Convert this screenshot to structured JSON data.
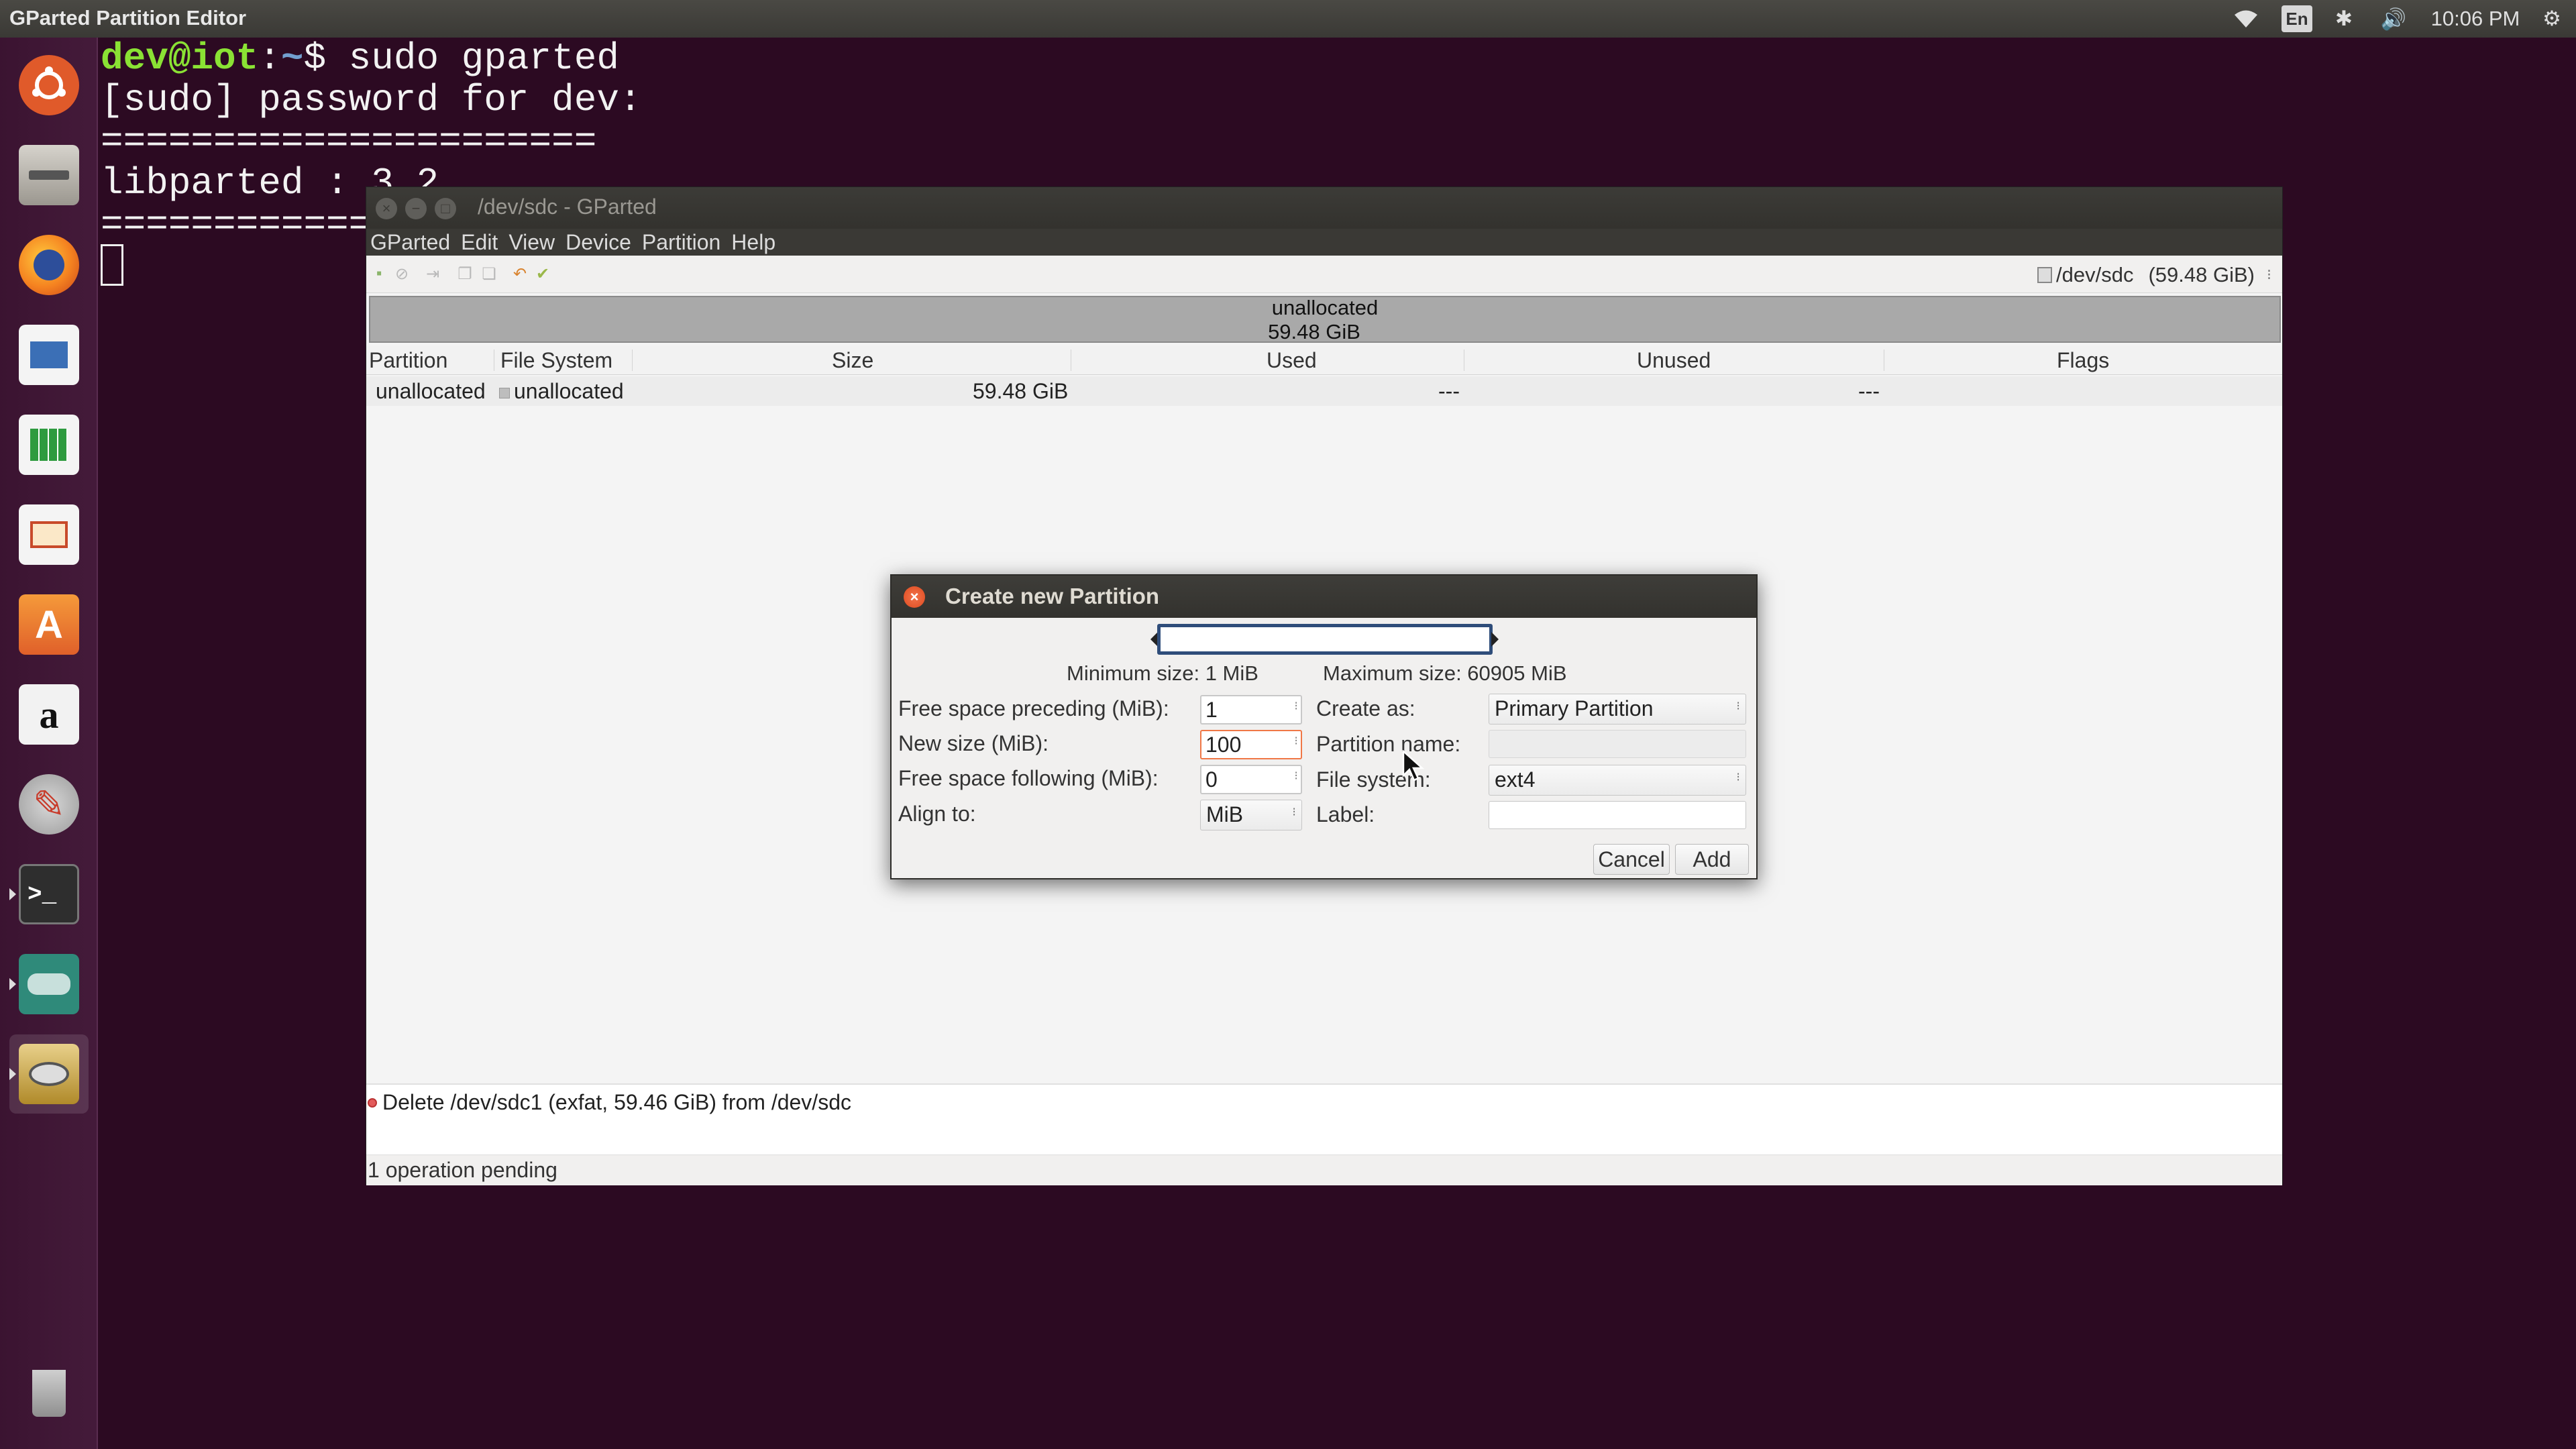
{
  "top_panel": {
    "title": "GParted Partition Editor",
    "lang": "En",
    "time": "10:06 PM"
  },
  "launcher": {
    "items": [
      {
        "name": "ubuntu-dash",
        "icon": "ubuntu-logo-icon"
      },
      {
        "name": "files",
        "icon": "file-cabinet-icon"
      },
      {
        "name": "firefox",
        "icon": "firefox-icon"
      },
      {
        "name": "writer",
        "icon": "document-icon"
      },
      {
        "name": "calc",
        "icon": "spreadsheet-icon"
      },
      {
        "name": "impress",
        "icon": "presentation-icon"
      },
      {
        "name": "software",
        "icon": "shopping-bag-icon",
        "glyph": "A"
      },
      {
        "name": "amazon",
        "icon": "amazon-icon",
        "glyph": "a"
      },
      {
        "name": "settings",
        "icon": "wrench-icon"
      },
      {
        "name": "terminal",
        "icon": "terminal-icon",
        "glyph": ">_"
      },
      {
        "name": "gamepad",
        "icon": "gamepad-icon"
      },
      {
        "name": "gparted",
        "icon": "gparted-icon"
      },
      {
        "name": "trash",
        "icon": "trash-icon"
      }
    ],
    "colors": {
      "ubuntu": "#e05a2a",
      "firefox": "#f58220",
      "writer": "#3b6fb6",
      "calc": "#2e9b3f",
      "impress": "#c84a2a",
      "software": "#f07830",
      "amazon": "#2b2b2b",
      "settings": "#c83c2c",
      "terminal": "#2e2e2e",
      "gamepad": "#2f8a7a",
      "gparted": "#c9a13a",
      "trash": "#666"
    }
  },
  "terminal": {
    "line1_user": "dev@iot",
    "line1_sep": ":",
    "line1_path": "~",
    "line1_cmd": "$ sudo gparted",
    "line2": "[sudo] password for dev:",
    "line3": "======================",
    "line4": "libparted : 3.2",
    "line5": "======================"
  },
  "gparted": {
    "title": "/dev/sdc - GParted",
    "menu": [
      "GParted",
      "Edit",
      "View",
      "Device",
      "Partition",
      "Help"
    ],
    "toolbar_icons": [
      "new-icon",
      "delete-icon",
      "resize-icon",
      "copy-icon",
      "paste-icon",
      "undo-icon",
      "apply-icon"
    ],
    "device": "/dev/sdc",
    "device_size": "(59.48 GiB)",
    "graph_label": "unallocated",
    "graph_size": "59.48 GiB",
    "columns": {
      "partition": "Partition",
      "filesystem": "File System",
      "size": "Size",
      "used": "Used",
      "unused": "Unused",
      "flags": "Flags"
    },
    "row": {
      "partition": "unallocated",
      "filesystem": "unallocated",
      "size": "59.48 GiB",
      "used": "---",
      "unused": "---",
      "flags": ""
    },
    "pending_op": "Delete /dev/sdc1 (exfat, 59.46 GiB) from /dev/sdc",
    "status": "1 operation pending"
  },
  "dialog": {
    "title": "Create new Partition",
    "min_size": "Minimum size: 1 MiB",
    "max_size": "Maximum size: 60905 MiB",
    "free_preceding_label": "Free space preceding (MiB):",
    "free_preceding_value": "1",
    "new_size_label": "New size (MiB):",
    "new_size_value": "100",
    "free_following_label": "Free space following (MiB):",
    "free_following_value": "0",
    "align_label": "Align to:",
    "align_value": "MiB",
    "create_as_label": "Create as:",
    "create_as_value": "Primary Partition",
    "partition_name_label": "Partition name:",
    "filesystem_label": "File system:",
    "filesystem_value": "ext4",
    "label_label": "Label:",
    "cancel": "Cancel",
    "add": "Add"
  }
}
